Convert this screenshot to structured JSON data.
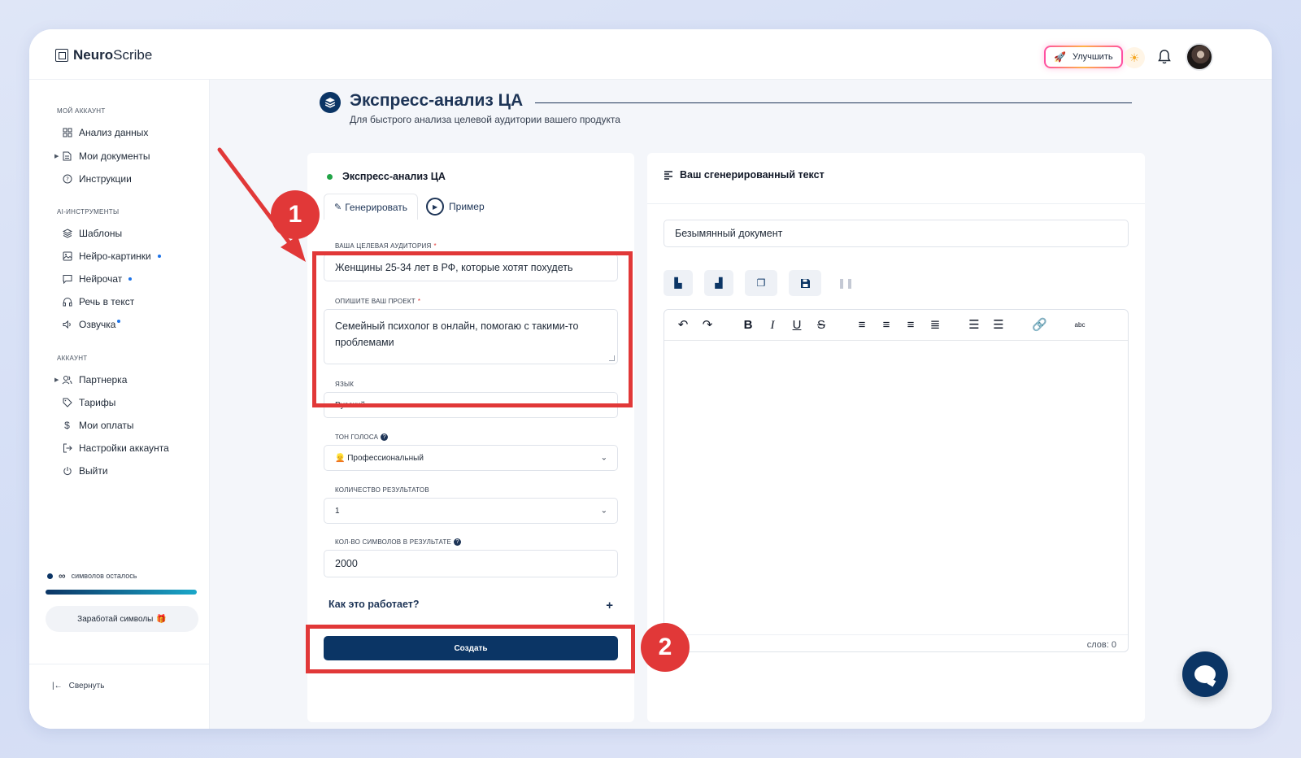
{
  "app": {
    "logo_prefix": "Neuro",
    "logo_suffix": "Scribe",
    "upgrade_label": "Улучшить"
  },
  "sidebar": {
    "sections": [
      {
        "title": "Мой аккаунт"
      },
      {
        "title": "AI-инструменты"
      },
      {
        "title": "Аккаунт"
      }
    ],
    "account_items": [
      {
        "label": "Анализ данных",
        "icon": "grid-icon"
      },
      {
        "label": "Мои документы",
        "icon": "document-icon"
      },
      {
        "label": "Инструкции",
        "icon": "help-icon"
      }
    ],
    "ai_items": [
      {
        "label": "Шаблоны",
        "icon": "layers-icon"
      },
      {
        "label": "Нейро-картинки",
        "icon": "image-icon"
      },
      {
        "label": "Нейрочат",
        "icon": "chat-icon"
      },
      {
        "label": "Речь в текст",
        "icon": "headphones-icon"
      },
      {
        "label": "Озвучка",
        "icon": "speaker-icon"
      }
    ],
    "settings_items": [
      {
        "label": "Партнерка",
        "icon": "users-icon"
      },
      {
        "label": "Тарифы",
        "icon": "tag-icon"
      },
      {
        "label": "Мои оплаты",
        "icon": "dollar-icon"
      },
      {
        "label": "Настройки аккаунта",
        "icon": "logout-icon"
      },
      {
        "label": "Выйти",
        "icon": "power-icon"
      }
    ],
    "credits_symbol": "∞",
    "credits_text": "символов осталось",
    "credits_fill": 1.0,
    "earn_label": "Заработай символы",
    "collapse_label": "Свернуть"
  },
  "page": {
    "title": "Экспресс-анализ ЦА",
    "subtitle": "Для быстрого анализа целевой аудитории вашего продукта"
  },
  "form": {
    "card_title": "Экспресс-анализ ЦА",
    "tab_generate": "Генерировать",
    "tab_example": "Пример",
    "audience_label": "Ваша целевая аудитория",
    "audience_value": "Женщины 25-34 лет в РФ, которые хотят похудеть",
    "project_label": "Опишите ваш проект",
    "project_value": "Семейный психолог в онлайн, помогаю с такими-то проблемами",
    "language_label": "Язык",
    "language_value": "Русский",
    "tone_label": "Тон голоса",
    "tone_value": "👱 Профессиональный",
    "results_label": "Количество результатов",
    "results_value": "1",
    "chars_label": "Кол-во символов в результате",
    "chars_value": "2000",
    "how_label": "Как это работает?",
    "create_label": "Создать"
  },
  "output": {
    "title": "Ваш сгенерированный текст",
    "doc_name": "Безымянный документ",
    "words_label": "слов: 0"
  },
  "annotations": {
    "step1": "1",
    "step2": "2"
  }
}
